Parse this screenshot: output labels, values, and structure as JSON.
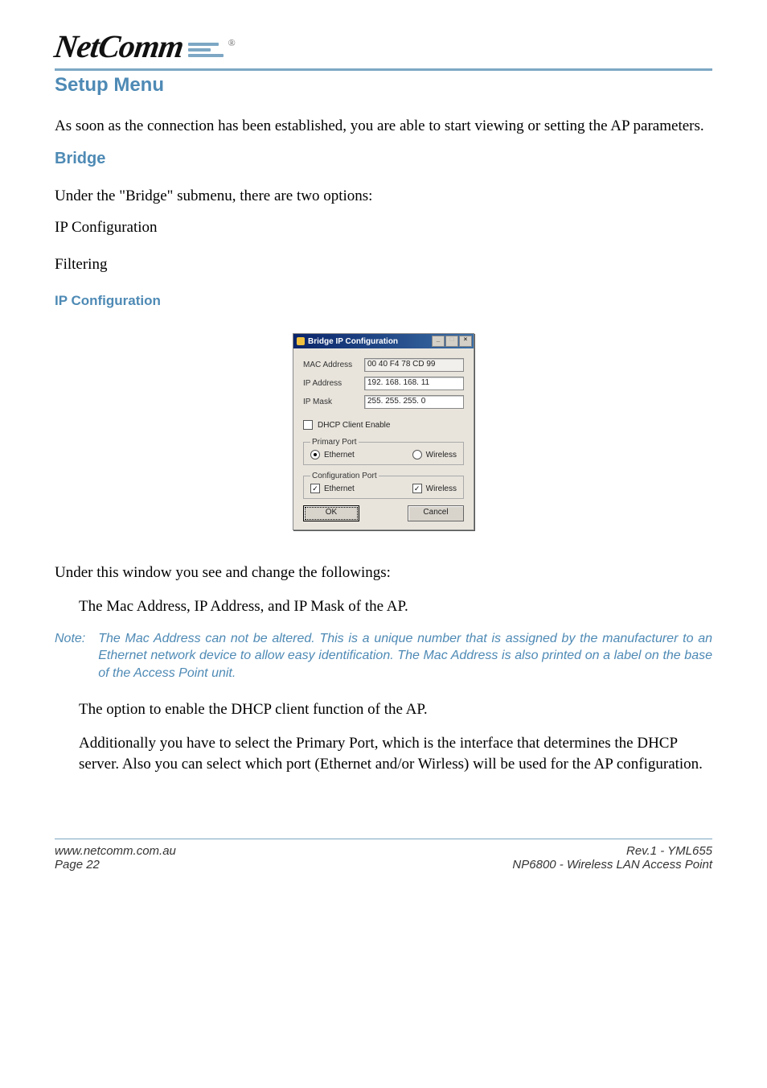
{
  "logo": {
    "text": "NetComm",
    "reg": "®"
  },
  "heading1": "Setup Menu",
  "intro": "As soon as the connection has been established, you are able to start viewing or setting the AP parameters.",
  "heading2": "Bridge",
  "bridge_intro": "Under the \"Bridge\" submenu, there are two options:",
  "options": {
    "item1": "IP Configuration",
    "item2": "Filtering"
  },
  "heading3": "IP Configuration",
  "dialog": {
    "title": "Bridge IP Configuration",
    "win_min": "_",
    "win_max": "□",
    "win_close": "×",
    "mac_label": "MAC Address",
    "mac_value": "00 40 F4 78 CD 99",
    "ip_label": "IP Address",
    "ip_value": "192. 168. 168.  11",
    "mask_label": "IP Mask",
    "mask_value": "255. 255. 255.   0",
    "dhcp_label": "DHCP Client Enable",
    "dhcp_checked": false,
    "primary_legend": "Primary Port",
    "primary_eth_label": "Ethernet",
    "primary_eth_selected": true,
    "primary_wl_label": "Wireless",
    "primary_wl_selected": false,
    "config_legend": "Configuration Port",
    "config_eth_label": "Ethernet",
    "config_eth_checked": true,
    "config_wl_label": "Wireless",
    "config_wl_checked": true,
    "ok_label": "OK",
    "cancel_label": "Cancel"
  },
  "after_dialog": "Under this window you see and change the followings:",
  "bullet1": "The Mac Address, IP Address, and  IP Mask of the AP.",
  "note": {
    "label": "Note:",
    "text": "The Mac Address can not be altered.  This is a unique number that is assigned by the manufacturer to an Ethernet network device to allow easy identification.  The Mac Address is also printed on a label on the base of the Access Point unit."
  },
  "bullet2": "The option to enable the DHCP client function of the AP.",
  "bullet3": "Additionally you have to select the Primary Port, which is the interface that determines the DHCP server. Also you can select which port (Ethernet and/or Wirless) will be used for the AP configuration.",
  "footer": {
    "url": "www.netcomm.com.au",
    "page": "Page 22",
    "rev": "Rev.1 - YML655",
    "product": "NP6800 - Wireless LAN Access Point"
  }
}
